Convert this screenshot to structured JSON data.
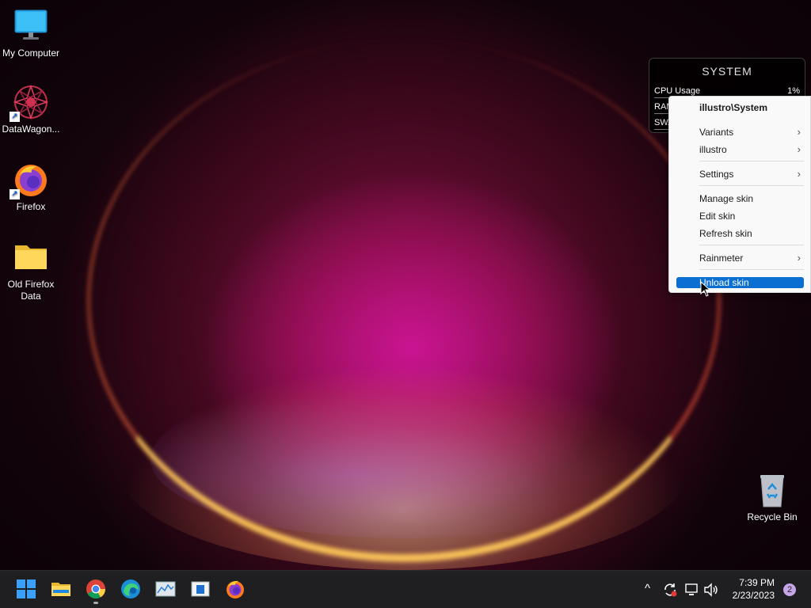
{
  "desktop": {
    "icons": [
      {
        "label": "My Computer",
        "icon": "monitor-icon"
      },
      {
        "label": "DataWagon...",
        "icon": "datawagon-icon"
      },
      {
        "label": "Firefox",
        "icon": "firefox-icon"
      },
      {
        "label": "Old Firefox Data",
        "icon": "folder-icon"
      },
      {
        "label": "Recycle Bin",
        "icon": "recycle-bin-icon"
      }
    ]
  },
  "widget": {
    "title": "SYSTEM",
    "rows": [
      {
        "label": "CPU Usage",
        "value": "1%"
      },
      {
        "label": "RAM",
        "value": ""
      },
      {
        "label": "SWA",
        "value": ""
      }
    ]
  },
  "context_menu": {
    "header": "illustro\\System",
    "items": [
      {
        "label": "Variants",
        "submenu": true
      },
      {
        "label": "illustro",
        "submenu": true
      },
      {
        "label": "Settings",
        "submenu": true
      },
      {
        "label": "Manage skin",
        "submenu": false
      },
      {
        "label": "Edit skin",
        "submenu": false
      },
      {
        "label": "Refresh skin",
        "submenu": false
      },
      {
        "label": "Rainmeter",
        "submenu": true
      },
      {
        "label": "Unload skin",
        "submenu": false,
        "highlighted": true
      }
    ],
    "chevron": "›"
  },
  "taskbar": {
    "apps": [
      "start-icon",
      "file-explorer-icon",
      "chrome-icon",
      "edge-icon",
      "resource-monitor-icon",
      "app-window-icon",
      "firefox-icon"
    ],
    "tray": {
      "chevron": "^",
      "time": "7:39 PM",
      "date": "2/23/2023",
      "notification_count": "2"
    }
  },
  "colors": {
    "accent": "#0a6fd1",
    "taskbar": "#1f1f22",
    "menu_bg": "#f9f9f9"
  }
}
